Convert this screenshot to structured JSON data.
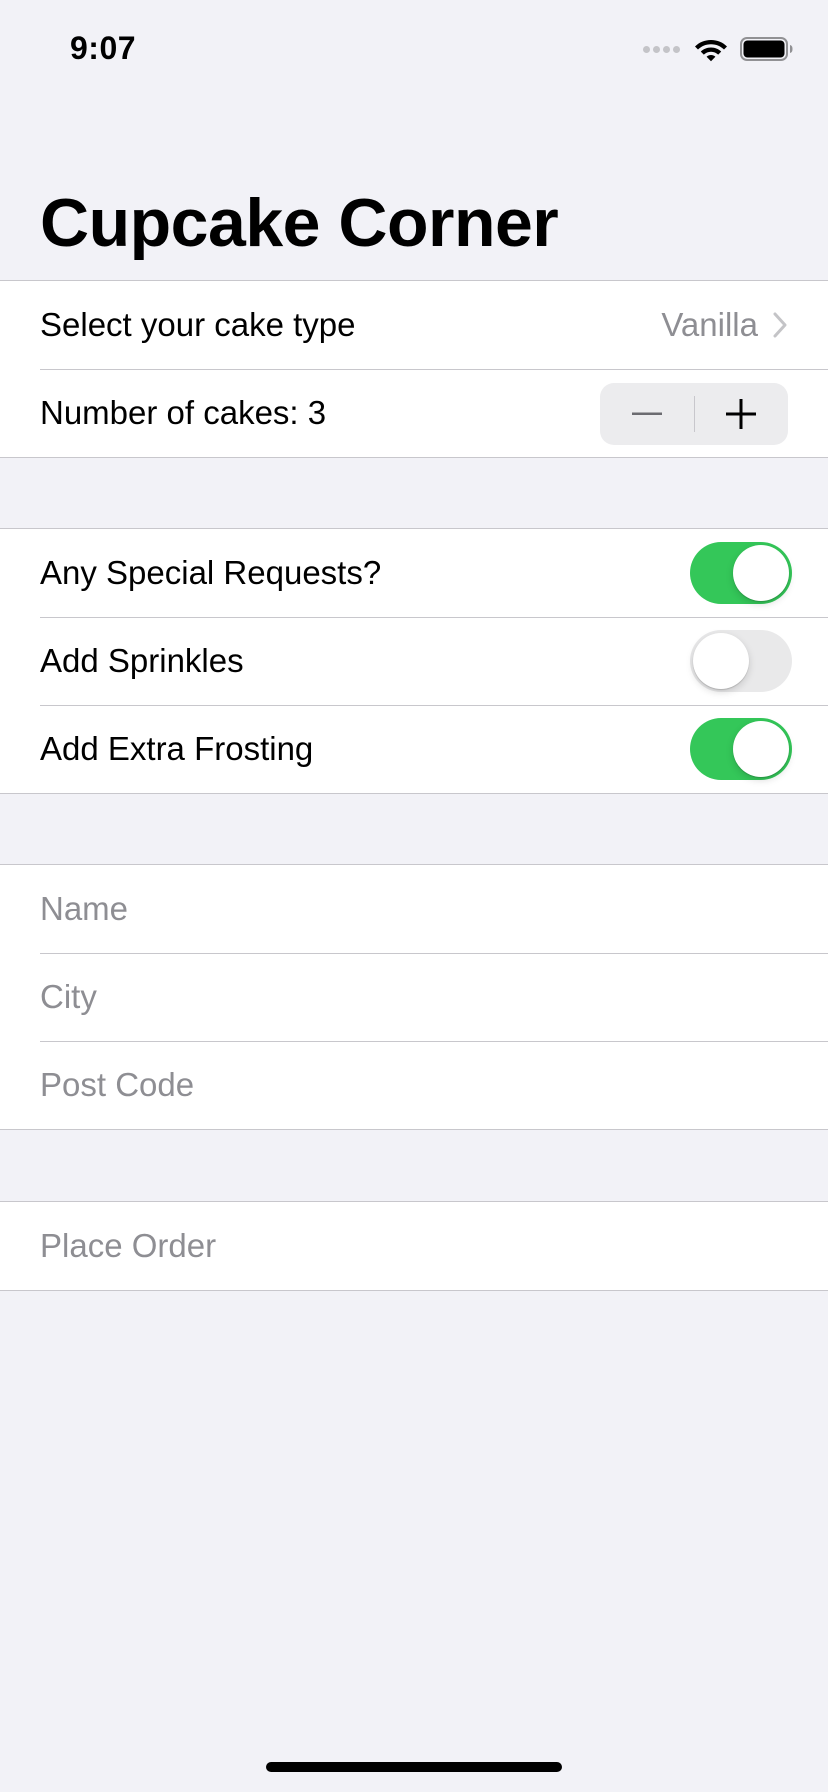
{
  "status_bar": {
    "time": "9:07",
    "signal_icon": "signal-dots-icon",
    "wifi_icon": "wifi-icon",
    "battery_icon": "battery-icon"
  },
  "nav": {
    "title": "Cupcake Corner"
  },
  "order_section": {
    "cake_type_label": "Select your cake type",
    "cake_type_value": "Vanilla",
    "quantity_label": "Number of cakes: 3",
    "stepper_minus_icon": "minus-icon",
    "stepper_plus_icon": "plus-icon"
  },
  "options_section": {
    "special_requests_label": "Any Special Requests?",
    "special_requests_on": true,
    "sprinkles_label": "Add Sprinkles",
    "sprinkles_on": false,
    "extra_frosting_label": "Add Extra Frosting",
    "extra_frosting_on": true
  },
  "address_section": {
    "name_placeholder": "Name",
    "city_placeholder": "City",
    "post_code_placeholder": "Post Code"
  },
  "checkout_section": {
    "place_order_label": "Place Order"
  },
  "colors": {
    "background": "#f2f2f7",
    "toggle_on": "#34c759",
    "toggle_off": "#e9e9ea",
    "secondary_text": "#8e8e93",
    "separator": "#c8c7cc"
  }
}
